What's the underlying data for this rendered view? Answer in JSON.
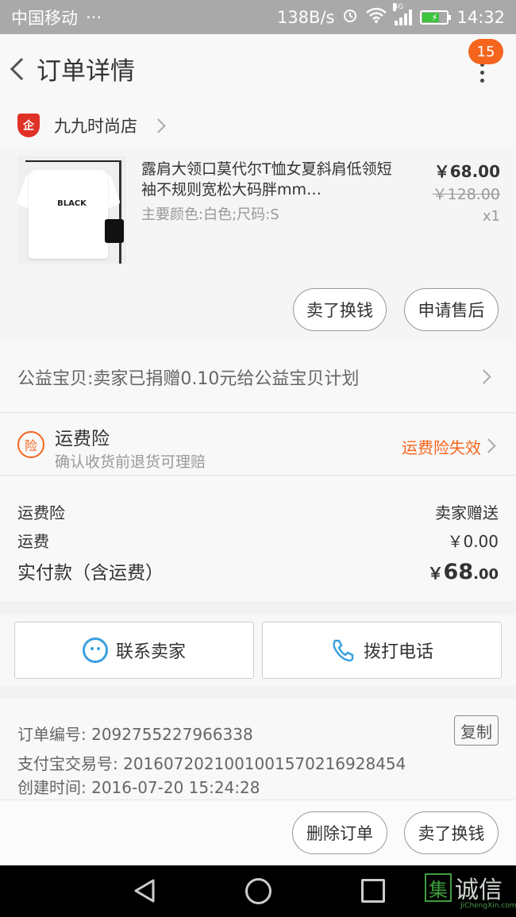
{
  "status_bar": {
    "carrier": "中国移动",
    "dots": "···",
    "speed": "138B/s",
    "net": "4G",
    "time": "14:32",
    "colors": {
      "bar": "#a9a9a9",
      "battery": "#3dc43d"
    }
  },
  "header": {
    "title": "订单详情",
    "badge_count": "15",
    "accent": "#f5651e"
  },
  "store": {
    "icon_text": "企",
    "name": "九九时尚店"
  },
  "product": {
    "name": "露肩大领口莫代尔T恤女夏斜肩低领短袖不规则宽松大码胖mm女装",
    "name_display": "露肩大领口莫代尔T恤女夏斜肩低领短袖不规则宽松大码胖mm…",
    "spec": "主要颜色:白色;尺码:S",
    "price": "￥68.00",
    "original_price": "￥128.00",
    "quantity": "x1",
    "image_print": "BLACK",
    "buttons": {
      "resell": "卖了换钱",
      "after_sale": "申请售后"
    }
  },
  "charity": {
    "text": "公益宝贝:卖家已捐赠0.10元给公益宝贝计划"
  },
  "insurance": {
    "icon_text": "险",
    "title": "运费险",
    "subtitle": "确认收货前退货可理赔",
    "status": "运费险失效"
  },
  "fees": {
    "insurance_label": "运费险",
    "insurance_value": "卖家赠送",
    "shipping_label": "运费",
    "shipping_value": "￥0.00",
    "total_label": "实付款（含运费）",
    "total_yen": "￥",
    "total_int": "68",
    "total_dec": ".00"
  },
  "contact": {
    "seller": "联系卖家",
    "call": "拨打电话"
  },
  "order_info": {
    "order_no": "订单编号: 2092755227966338",
    "alipay_no": "支付宝交易号: 2016072021001001570216928454",
    "created": "创建时间: 2016-07-20 15:24:28",
    "copy": "复制"
  },
  "actions": {
    "delete": "删除订单",
    "resell": "卖了换钱"
  },
  "watermark": {
    "box": "集",
    "text": "诚信",
    "sub": "JiChengXin.com"
  }
}
